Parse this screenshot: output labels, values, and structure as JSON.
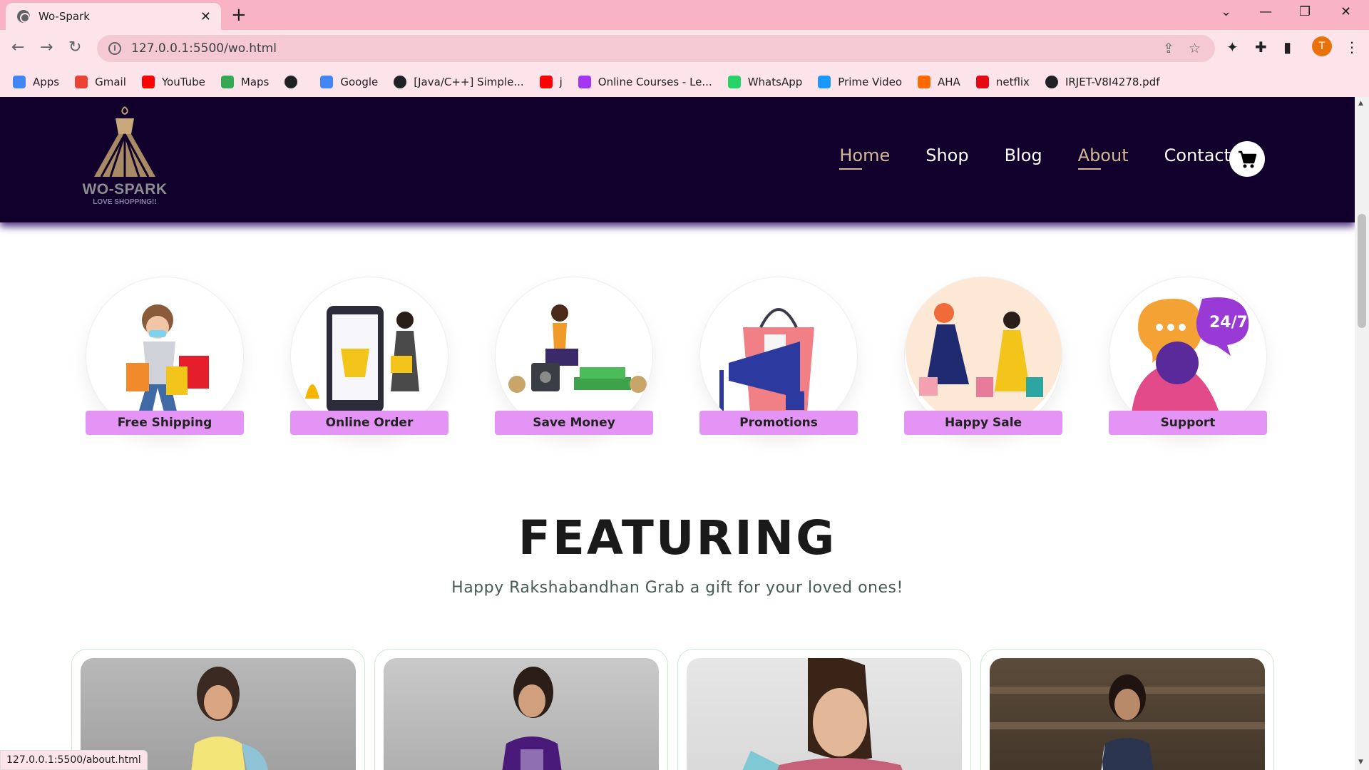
{
  "browser": {
    "tab_title": "Wo-Spark",
    "url": "127.0.0.1:5500/wo.html",
    "profile_initial": "T",
    "status_url": "127.0.0.1:5500/about.html",
    "bookmarks": [
      {
        "label": "Apps",
        "icon": "apps-grid-icon",
        "color": "#4285f4"
      },
      {
        "label": "Gmail",
        "icon": "gmail-icon",
        "color": "#ea4335"
      },
      {
        "label": "YouTube",
        "icon": "youtube-icon",
        "color": "#ff0000"
      },
      {
        "label": "Maps",
        "icon": "maps-icon",
        "color": "#34a853"
      },
      {
        "label": "",
        "icon": "globe-icon",
        "color": "#202124"
      },
      {
        "label": "Google",
        "icon": "google-icon",
        "color": "#4285f4"
      },
      {
        "label": "[Java/C++] Simple...",
        "icon": "code-icon",
        "color": "#202124"
      },
      {
        "label": "j",
        "icon": "youtube-icon",
        "color": "#ff0000"
      },
      {
        "label": "Online Courses - Le...",
        "icon": "udemy-icon",
        "color": "#a435f0"
      },
      {
        "label": "WhatsApp",
        "icon": "whatsapp-icon",
        "color": "#25d366"
      },
      {
        "label": "Prime Video",
        "icon": "prime-video-icon",
        "color": "#1a98ff"
      },
      {
        "label": "AHA",
        "icon": "aha-icon",
        "color": "#ff6a00"
      },
      {
        "label": "netflix",
        "icon": "netflix-icon",
        "color": "#e50914"
      },
      {
        "label": "IRJET-V8I4278.pdf",
        "icon": "globe-icon",
        "color": "#202124"
      }
    ]
  },
  "site": {
    "logo": {
      "brand": "WO-SPARK",
      "tagline": "LOVE SHOPPING!!"
    },
    "nav": [
      {
        "label": "Home",
        "active": true
      },
      {
        "label": "Shop",
        "active": false
      },
      {
        "label": "Blog",
        "active": false
      },
      {
        "label": "About",
        "active": true
      },
      {
        "label": "Contact",
        "active": false
      }
    ],
    "features": [
      {
        "label": "Free Shipping",
        "icon": "free-shipping-illustration"
      },
      {
        "label": "Online Order",
        "icon": "online-order-illustration"
      },
      {
        "label": "Save Money",
        "icon": "save-money-illustration"
      },
      {
        "label": "Promotions",
        "icon": "promotions-illustration"
      },
      {
        "label": "Happy Sale",
        "icon": "happy-sale-illustration"
      },
      {
        "label": "Support",
        "icon": "support-illustration"
      }
    ],
    "featuring": {
      "title": "FEATURING",
      "subtitle": "Happy Rakshabandhan Grab a gift for your loved ones!"
    },
    "colors": {
      "header_bg": "#10002b",
      "feature_label_bg": "#e394f5",
      "nav_active": "#d4b896"
    }
  }
}
